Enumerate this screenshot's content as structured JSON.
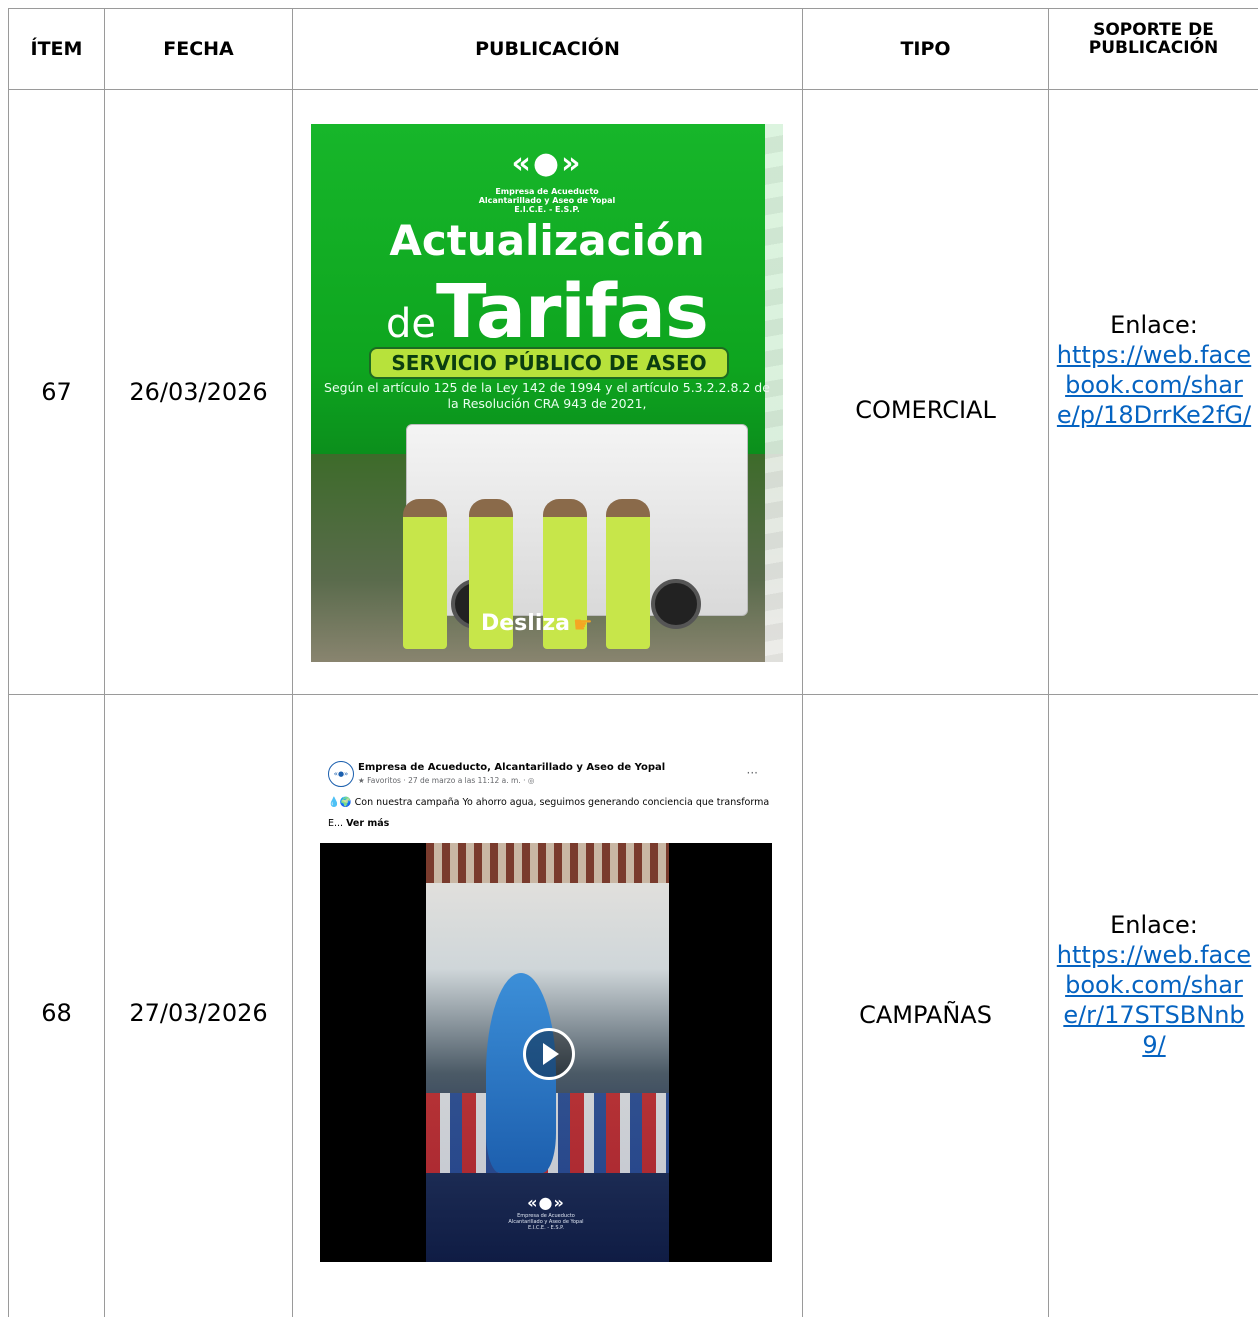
{
  "headers": {
    "item": "ÍTEM",
    "fecha": "FECHA",
    "publicacion": "PUBLICACIÓN",
    "tipo": "TIPO",
    "soporte_line1": "SOPORTE DE",
    "soporte_line2": "PUBLICACIÓN"
  },
  "rows": [
    {
      "item": "67",
      "fecha": "26/03/2026",
      "tipo": "COMERCIAL",
      "enlace_label": "Enlace:",
      "enlace_url": "https://web.facebook.com/share/p/18DrrKe2fG/",
      "poster": {
        "logo": "«●»",
        "org": "Empresa de Acueducto\nAlcantarillado y Aseo de Yopal\nE.I.C.E. - E.S.P.",
        "title_line1": "Actualización",
        "title_de": "de",
        "title_line2": "Tarifas",
        "badge": "SERVICIO PÚBLICO DE ASEO",
        "note": "Según el artículo 125 de la Ley 142 de 1994 y el artículo 5.3.2.2.8.2 de la Resolución CRA 943 de 2021,",
        "desliza": "Desliza",
        "hand": "☛"
      }
    },
    {
      "item": "68",
      "fecha": "27/03/2026",
      "tipo": "CAMPAÑAS",
      "enlace_label": "Enlace:",
      "enlace_url": "https://web.facebook.com/share/r/17STSBNnb9/",
      "post": {
        "page_name": "Empresa de Acueducto, Alcantarillado y Aseo de Yopal",
        "meta": "★ Favoritos · 27 de marzo a las 11:12 a. m. · ◎",
        "more": "···",
        "caption": "💧🌍 Con nuestra campaña Yo ahorro agua, seguimos generando conciencia que transforma",
        "caption_prefix": "E...",
        "ver_mas": "Ver más",
        "video_logo": "«●»",
        "video_org": "Empresa de Acueducto\nAlcantarillado y Aseo de Yopal\nE.I.C.E. - E.S.P."
      }
    }
  ],
  "colors": {
    "link": "#0563c1",
    "grid": "#9a9a9a",
    "poster_green": "#17b62a"
  }
}
